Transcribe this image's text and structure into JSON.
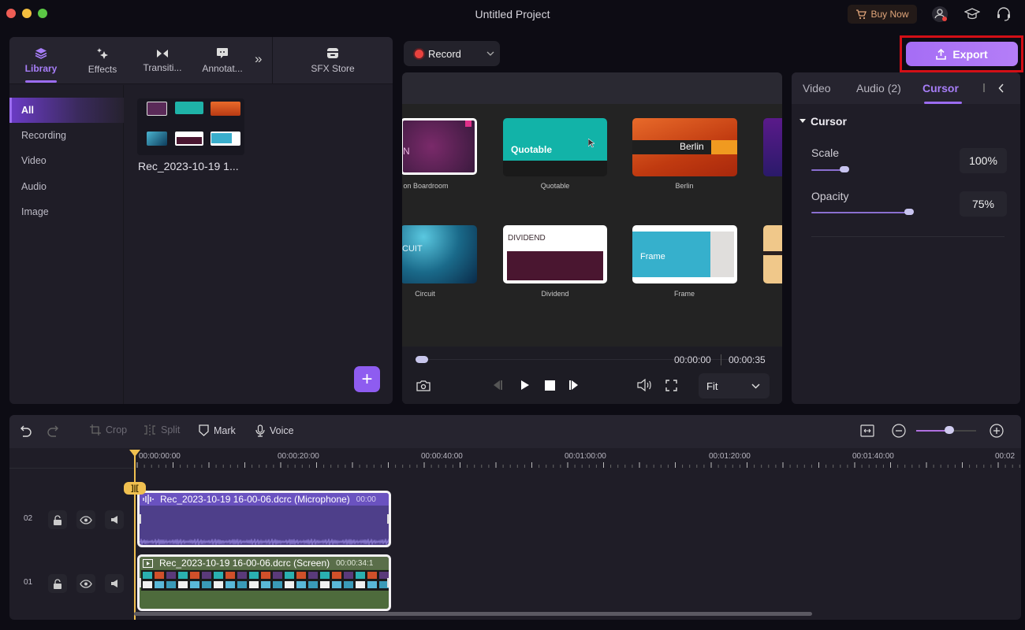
{
  "window": {
    "title": "Untitled Project",
    "traffic_lights": {
      "close": "#ee5d55",
      "minimize": "#f3be3e",
      "zoom": "#5bc845"
    },
    "buy_now_label": "Buy Now",
    "icons": [
      "cart-icon",
      "account-icon",
      "academy-cap-icon",
      "support-headset-icon"
    ]
  },
  "left_panel": {
    "tabs": [
      {
        "label": "Library",
        "icon": "layers-icon",
        "active": true
      },
      {
        "label": "Effects",
        "icon": "sparkle-icon",
        "active": false
      },
      {
        "label": "Transiti...",
        "icon": "transition-icon",
        "active": false
      },
      {
        "label": "Annotat...",
        "icon": "annotation-icon",
        "active": false
      }
    ],
    "more_label": "»",
    "sfx_store_label": "SFX Store",
    "categories": [
      {
        "label": "All",
        "active": true
      },
      {
        "label": "Recording",
        "active": false
      },
      {
        "label": "Video",
        "active": false
      },
      {
        "label": "Audio",
        "active": false
      },
      {
        "label": "Image",
        "active": false
      }
    ],
    "media_items": [
      {
        "label": "Rec_2023-10-19 1..."
      }
    ],
    "add_button": "+"
  },
  "record": {
    "label": "Record"
  },
  "preview": {
    "templates": [
      {
        "name": "on Boardroom",
        "title_text": "N"
      },
      {
        "name": "Quotable",
        "title_text": "Quotable"
      },
      {
        "name": "Berlin",
        "title_text": "Berlin"
      },
      {
        "name": "Circuit",
        "title_text": "CUIT"
      },
      {
        "name": "Dividend",
        "title_text": "DIVIDEND"
      },
      {
        "name": "Frame",
        "title_text": "Frame"
      }
    ],
    "current_time": "00:00:00",
    "total_time": "00:00:35",
    "progress": 0.0,
    "zoom_select": "Fit"
  },
  "export": {
    "label": "Export",
    "accent": "#a56df5",
    "highlight_border": "#d30f16"
  },
  "right_panel": {
    "tabs": [
      {
        "label": "Video",
        "active": false
      },
      {
        "label": "Audio (2)",
        "active": false
      },
      {
        "label": "Cursor",
        "active": true
      }
    ],
    "section_title": "Cursor",
    "properties": [
      {
        "label": "Scale",
        "value": "100%",
        "slider_fraction": 0.28
      },
      {
        "label": "Opacity",
        "value": "75%",
        "slider_fraction": 0.75
      }
    ]
  },
  "timeline": {
    "tools": [
      {
        "label": "Crop",
        "enabled": false,
        "icon": "crop-icon"
      },
      {
        "label": "Split",
        "enabled": false,
        "icon": "split-icon"
      },
      {
        "label": "Mark",
        "enabled": true,
        "icon": "mark-icon"
      },
      {
        "label": "Voice",
        "enabled": true,
        "icon": "microphone-icon"
      }
    ],
    "zoom_fraction": 0.55,
    "ruler_labels": [
      "00:00:00:00",
      "00:00:20:00",
      "00:00:40:00",
      "00:01:00:00",
      "00:01:20:00",
      "00:01:40:00",
      "00:02"
    ],
    "tracks": [
      {
        "number": "02",
        "clip_name": "Rec_2023-10-19 16-00-06.dcrc (Microphone)",
        "clip_duration": "00:00",
        "type": "audio",
        "color": "#4e3f8a"
      },
      {
        "number": "01",
        "clip_name": "Rec_2023-10-19 16-00-06.dcrc (Screen)",
        "clip_duration": "00:00:34:1",
        "type": "video",
        "color": "#4e6b3c"
      }
    ]
  }
}
